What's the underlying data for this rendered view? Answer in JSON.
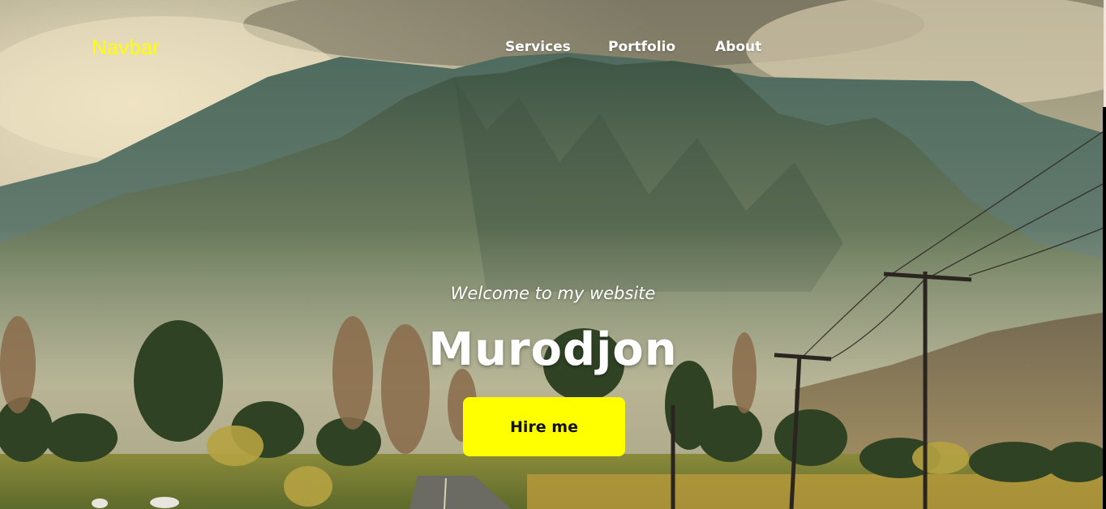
{
  "navbar": {
    "brand": "Navbar",
    "links": [
      {
        "label": "Services"
      },
      {
        "label": "Portfolio"
      },
      {
        "label": "About"
      }
    ]
  },
  "hero": {
    "welcome": "Welcome to my website",
    "name": "Murodjon",
    "cta_label": "Hire me",
    "background_description": "mountain-landscape-photo"
  },
  "colors": {
    "brand": "#ffff00",
    "cta_background": "#ffff00",
    "text": "#ffffff"
  }
}
